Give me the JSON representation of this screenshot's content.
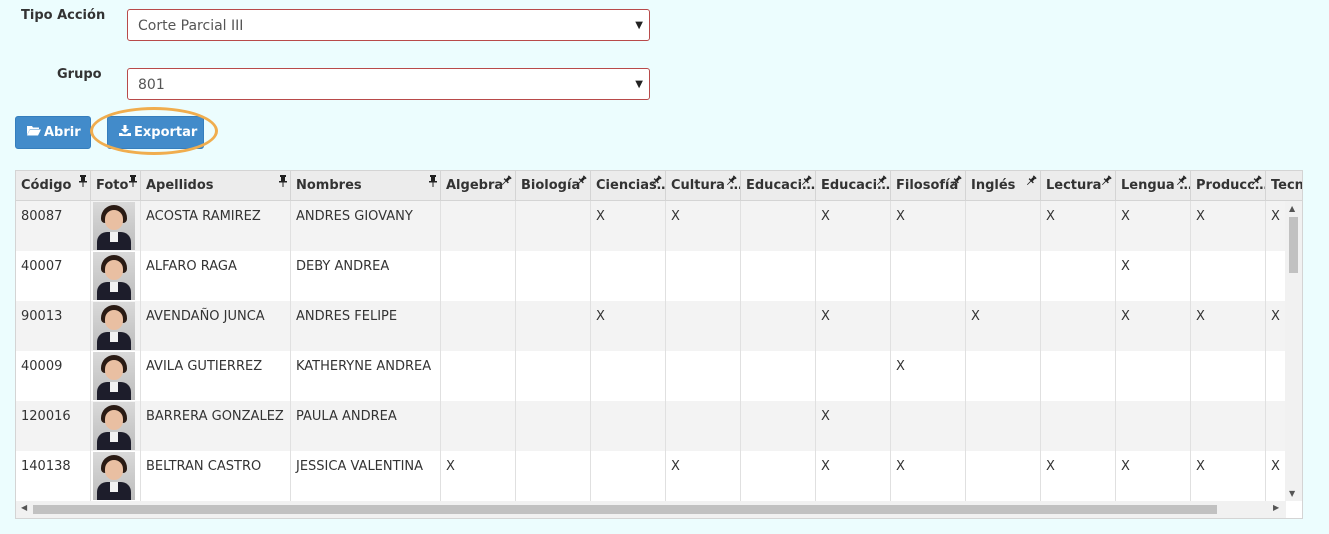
{
  "form": {
    "tipo_label": "Tipo Acción",
    "tipo_value": "Corte Parcial III",
    "grupo_label": "Grupo",
    "grupo_value": "801"
  },
  "buttons": {
    "abrir": "Abrir",
    "exportar": "Exportar"
  },
  "icons": {
    "abrir": "folder-open-icon",
    "exportar": "download-icon",
    "pin": "pin-icon",
    "caret": "caret-down-icon"
  },
  "colors": {
    "button": "#428bca",
    "focus_ring": "#f0ad4e",
    "select_border": "#b84a4a",
    "background": "#ecfdfe"
  },
  "table": {
    "columns": [
      "Código",
      "Foto",
      "Apellidos",
      "Nombres",
      "Algebra",
      "Biología",
      "Ciencias…",
      "Cultura …",
      "Educaci…",
      "Educaci…",
      "Filosofía",
      "Inglés",
      "Lectura",
      "Lengua …",
      "Producc…",
      "Tecn"
    ],
    "rows": [
      {
        "codigo": "80087",
        "apellidos": "ACOSTA RAMIREZ",
        "nombres": "ANDRES GIOVANY",
        "marks": [
          "",
          "",
          "X",
          "X",
          "",
          "X",
          "X",
          "",
          "X",
          "X",
          "X",
          "X"
        ]
      },
      {
        "codigo": "40007",
        "apellidos": "ALFARO RAGA",
        "nombres": "DEBY ANDREA",
        "marks": [
          "",
          "",
          "",
          "",
          "",
          "",
          "",
          "",
          "",
          "X",
          "",
          ""
        ]
      },
      {
        "codigo": "90013",
        "apellidos": "AVENDAÑO JUNCA",
        "nombres": "ANDRES FELIPE",
        "marks": [
          "",
          "",
          "X",
          "",
          "",
          "X",
          "",
          "X",
          "",
          "X",
          "X",
          "X"
        ]
      },
      {
        "codigo": "40009",
        "apellidos": "AVILA GUTIERREZ",
        "nombres": "KATHERYNE ANDREA",
        "marks": [
          "",
          "",
          "",
          "",
          "",
          "",
          "X",
          "",
          "",
          "",
          "",
          ""
        ]
      },
      {
        "codigo": "120016",
        "apellidos": "BARRERA GONZALEZ",
        "nombres": "PAULA ANDREA",
        "marks": [
          "",
          "",
          "",
          "",
          "",
          "X",
          "",
          "",
          "",
          "",
          "",
          ""
        ]
      },
      {
        "codigo": "140138",
        "apellidos": "BELTRAN CASTRO",
        "nombres": "JESSICA VALENTINA",
        "marks": [
          "X",
          "",
          "",
          "X",
          "",
          "X",
          "X",
          "",
          "X",
          "X",
          "X",
          "X"
        ]
      }
    ]
  }
}
